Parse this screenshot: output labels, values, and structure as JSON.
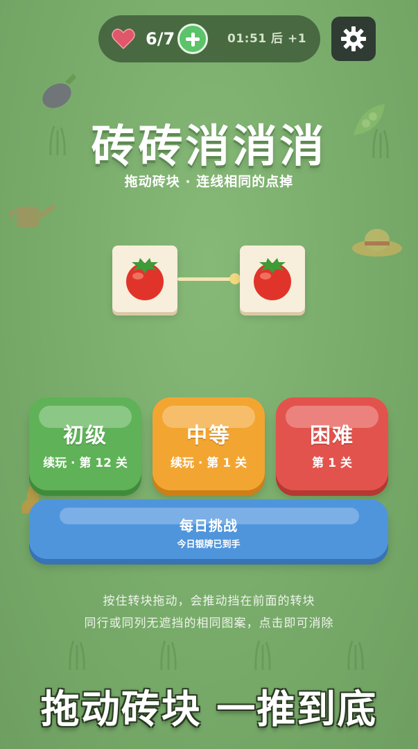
{
  "topbar": {
    "lives": "6/7",
    "timer": "01:51 后 +1"
  },
  "title": "砖砖消消消",
  "subtitle": "拖动砖块 · 连线相同的点掉",
  "demo": {
    "left_tile": "tomato",
    "right_tile": "tomato"
  },
  "levels": [
    {
      "label": "初级",
      "sub": "续玩 · 第 12 关",
      "color": "#5fb257"
    },
    {
      "label": "中等",
      "sub": "续玩 · 第 1 关",
      "color": "#f3a531"
    },
    {
      "label": "困难",
      "sub": "第 1 关",
      "color": "#e3534d"
    }
  ],
  "daily": {
    "label": "每日挑战",
    "sub": "今日银牌已到手",
    "color": "#4f95dc"
  },
  "instructions": [
    "按住转块拖动，会推动挡在前面的转块",
    "同行或同列无遮挡的相同图案，点击即可消除"
  ],
  "slogan": "拖动砖块 一推到底"
}
